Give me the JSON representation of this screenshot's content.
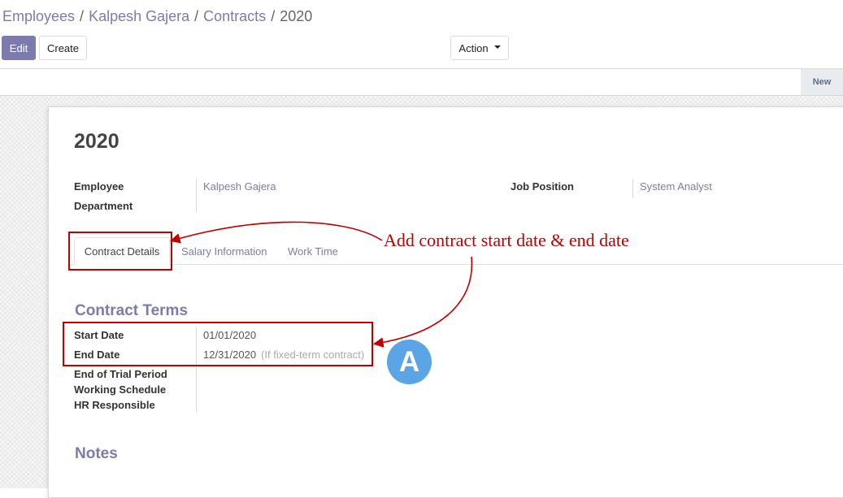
{
  "breadcrumb": {
    "items": [
      "Employees",
      "Kalpesh Gajera",
      "Contracts"
    ],
    "current": "2020",
    "separator": "/"
  },
  "toolbar": {
    "edit_label": "Edit",
    "create_label": "Create",
    "action_label": "Action"
  },
  "statusbar": {
    "stage_label": "New"
  },
  "form": {
    "title": "2020",
    "employee_label": "Employee",
    "employee_value": "Kalpesh Gajera",
    "department_label": "Department",
    "department_value": "",
    "job_position_label": "Job Position",
    "job_position_value": "System Analyst"
  },
  "tabs": [
    {
      "label": "Contract Details",
      "active": true
    },
    {
      "label": "Salary Information",
      "active": false
    },
    {
      "label": "Work Time",
      "active": false
    }
  ],
  "contract_terms": {
    "heading": "Contract Terms",
    "start_date_label": "Start Date",
    "start_date_value": "01/01/2020",
    "end_date_label": "End Date",
    "end_date_value": "12/31/2020",
    "end_date_hint": "(If fixed-term contract)",
    "trial_label": "End of Trial Period",
    "schedule_label": "Working Schedule",
    "hr_label": "HR Responsible"
  },
  "notes": {
    "heading": "Notes"
  },
  "annotation": {
    "text": "Add contract start date & end date",
    "badge": "A",
    "color": "#c00000",
    "badge_color": "#5ba4e5"
  },
  "colors": {
    "accent": "#7c7bad"
  }
}
